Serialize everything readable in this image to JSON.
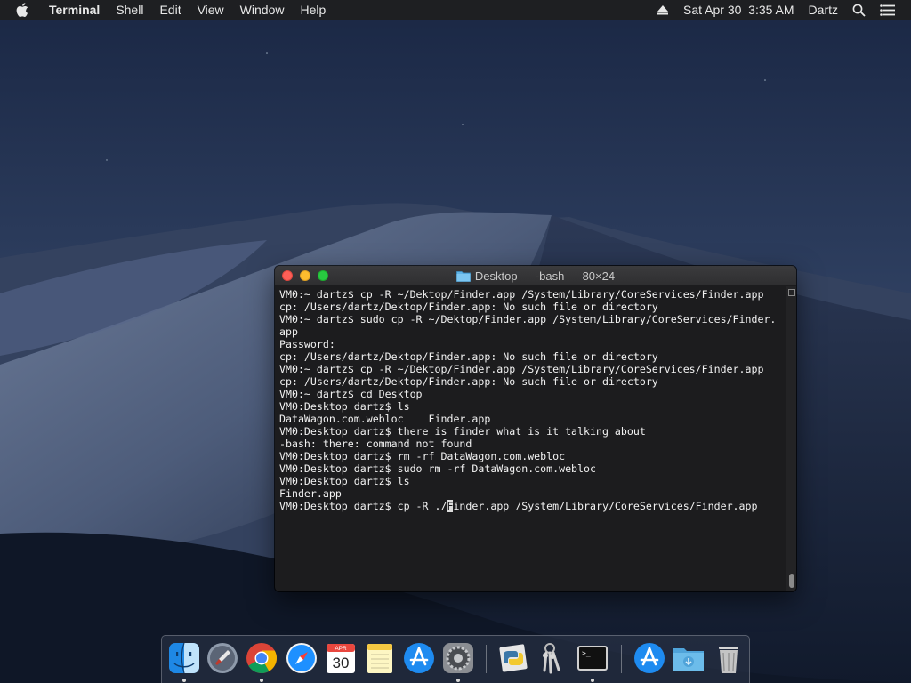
{
  "menubar": {
    "app_name": "Terminal",
    "menus": [
      "Shell",
      "Edit",
      "View",
      "Window",
      "Help"
    ],
    "datetime": "Sat Apr 30  3:35 AM",
    "user": "Dartz",
    "icons": [
      "apple-icon",
      "eject-icon",
      "spotlight-search-icon",
      "notification-center-icon"
    ]
  },
  "terminal": {
    "title": "Desktop — -bash — 80×24",
    "lines": [
      "VM0:~ dartz$ cp -R ~/Dektop/Finder.app /System/Library/CoreServices/Finder.app",
      "cp: /Users/dartz/Dektop/Finder.app: No such file or directory",
      "VM0:~ dartz$ sudo cp -R ~/Dektop/Finder.app /System/Library/CoreServices/Finder.",
      "app",
      "Password:",
      "cp: /Users/dartz/Dektop/Finder.app: No such file or directory",
      "VM0:~ dartz$ cp -R ~/Dektop/Finder.app /System/Library/CoreServices/Finder.app",
      "cp: /Users/dartz/Dektop/Finder.app: No such file or directory",
      "VM0:~ dartz$ cd Desktop",
      "VM0:Desktop dartz$ ls",
      "DataWagon.com.webloc    Finder.app",
      "VM0:Desktop dartz$ there is finder what is it talking about",
      "-bash: there: command not found",
      "VM0:Desktop dartz$ rm -rf DataWagon.com.webloc",
      "VM0:Desktop dartz$ sudo rm -rf DataWagon.com.webloc",
      "VM0:Desktop dartz$ ls",
      "Finder.app"
    ],
    "current_line": {
      "before_cursor": "VM0:Desktop dartz$ cp -R ./",
      "cursor_char": "F",
      "after_cursor": "inder.app /System/Library/CoreServices/Finder.app"
    }
  },
  "dock": {
    "apps": [
      "Finder",
      "Launchpad",
      "Google Chrome",
      "Safari",
      "Calendar",
      "Notes",
      "App Store",
      "System Preferences",
      "Python Launcher",
      "Keychain Access",
      "Terminal",
      "App Store",
      "Downloads",
      "Trash"
    ],
    "calendar_month": "APR",
    "calendar_day": "30",
    "terminal_prompt": ">_"
  },
  "colors": {
    "menubar_bg": "#1e1e20",
    "terminal_bg": "#1c1c1e",
    "terminal_text": "#f2f2f2",
    "close": "#fc5f57",
    "minimize": "#fdbc2e",
    "zoom": "#28c840"
  }
}
